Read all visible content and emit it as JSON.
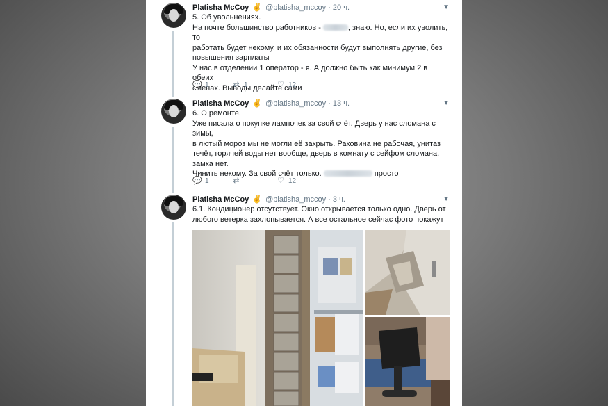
{
  "tweets": [
    {
      "name": "Platisha McCoy",
      "handle": "@platisha_mccoy",
      "time": "20 ч.",
      "lines": [
        "5. Об увольнениях.",
        "На почте большинство работников -",
        ", знаю. Но, если их уволить, то",
        "работать будет некому, и их обязанности будут выполнять другие, без",
        "повышения зарплаты",
        "У нас в отделении 1 оператор - я. А должно быть как минимум 2 в обеих",
        "сменах. Выводы делайте сами"
      ],
      "replies": "1",
      "retweets": "1",
      "likes": "12"
    },
    {
      "name": "Platisha McCoy",
      "handle": "@platisha_mccoy",
      "time": "13 ч.",
      "lines": [
        "6. О ремонте.",
        "Уже писала о покупке лампочек за свой счёт. Дверь у нас сломана с зимы,",
        "в лютый мороз мы не могли её закрыть. Раковина не рабочая, унитаз",
        "течёт, горячей воды нет вообще, дверь в комнату с сейфом сломана,",
        "замка нет.",
        "Чинить некому. За свой счёт только.",
        "просто"
      ],
      "replies": "1",
      "retweets": "",
      "likes": "12"
    },
    {
      "name": "Platisha McCoy",
      "handle": "@platisha_mccoy",
      "time": "3 ч.",
      "lines": [
        "6.1. Кондиционер отсутствует. Окно открывается только одно. Дверь от",
        "любого ветерка захлопывается. А все остальное сейчас фото покажут"
      ]
    }
  ],
  "icons": {
    "reply": "reply-icon",
    "retweet": "retweet-icon",
    "like": "heart-icon",
    "more": "chevron-down-icon",
    "verified": "badge-icon"
  },
  "colors": {
    "text": "#14171a",
    "secondary": "#657786",
    "thread_line": "#c4cfd6",
    "background": "#7a7a7a"
  }
}
